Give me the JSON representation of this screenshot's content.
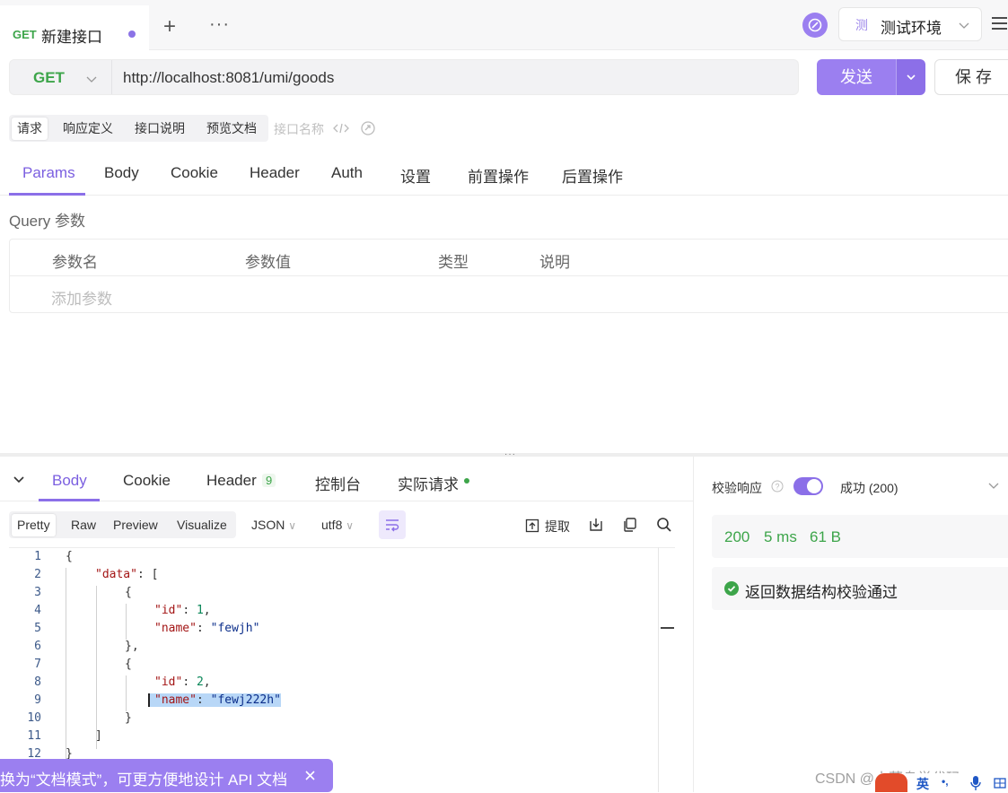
{
  "tab": {
    "method": "GET",
    "title": "新建接口"
  },
  "environment": {
    "badge": "测",
    "label": "测试环境"
  },
  "request": {
    "method": "GET",
    "url": "http://localhost:8081/umi/goods",
    "send_label": "发送",
    "save_label": "保 存"
  },
  "mode_tabs": [
    "请求",
    "响应定义",
    "接口说明",
    "预览文档"
  ],
  "api_name_placeholder": "接口名称",
  "request_tabs": [
    "Params",
    "Body",
    "Cookie",
    "Header",
    "Auth",
    "设置",
    "前置操作",
    "后置操作"
  ],
  "query": {
    "label": "Query 参数",
    "columns": [
      "参数名",
      "参数值",
      "类型",
      "说明"
    ],
    "add_placeholder": "添加参数"
  },
  "response_tabs": {
    "body": "Body",
    "cookie": "Cookie",
    "header": "Header",
    "header_count": "9",
    "console": "控制台",
    "actual": "实际请求"
  },
  "view_tabs": [
    "Pretty",
    "Raw",
    "Preview",
    "Visualize"
  ],
  "format": {
    "type": "JSON",
    "encoding": "utf8"
  },
  "extract_label": "提取",
  "code_lines": [
    {
      "n": "1",
      "t": "{"
    },
    {
      "n": "2",
      "t": "    \"data\": ["
    },
    {
      "n": "3",
      "t": "        {"
    },
    {
      "n": "4",
      "t": "            \"id\": 1,"
    },
    {
      "n": "5",
      "t": "            \"name\": \"fewjh\""
    },
    {
      "n": "6",
      "t": "        },"
    },
    {
      "n": "7",
      "t": "        {"
    },
    {
      "n": "8",
      "t": "            \"id\": 2,"
    },
    {
      "n": "9",
      "t": "            \"name\": \"fewj222h\""
    },
    {
      "n": "10",
      "t": "        }"
    },
    {
      "n": "11",
      "t": "    ]"
    },
    {
      "n": "12",
      "t": "}"
    }
  ],
  "verify": {
    "label": "校验响应",
    "enabled": true,
    "result": "成功 (200)",
    "status": "200",
    "time": "5 ms",
    "size": "61 B",
    "pass_message": "返回数据结构校验通过"
  },
  "toast": {
    "text": "换为“文档模式”，可更方便地设计 API 文档"
  },
  "watermark": "CSDN @小菜鸟学代码··",
  "ime": {
    "lang": "英"
  },
  "colors": {
    "accent": "#9b7ff0",
    "get_green": "#3da54a",
    "success_green": "#3da54a"
  }
}
